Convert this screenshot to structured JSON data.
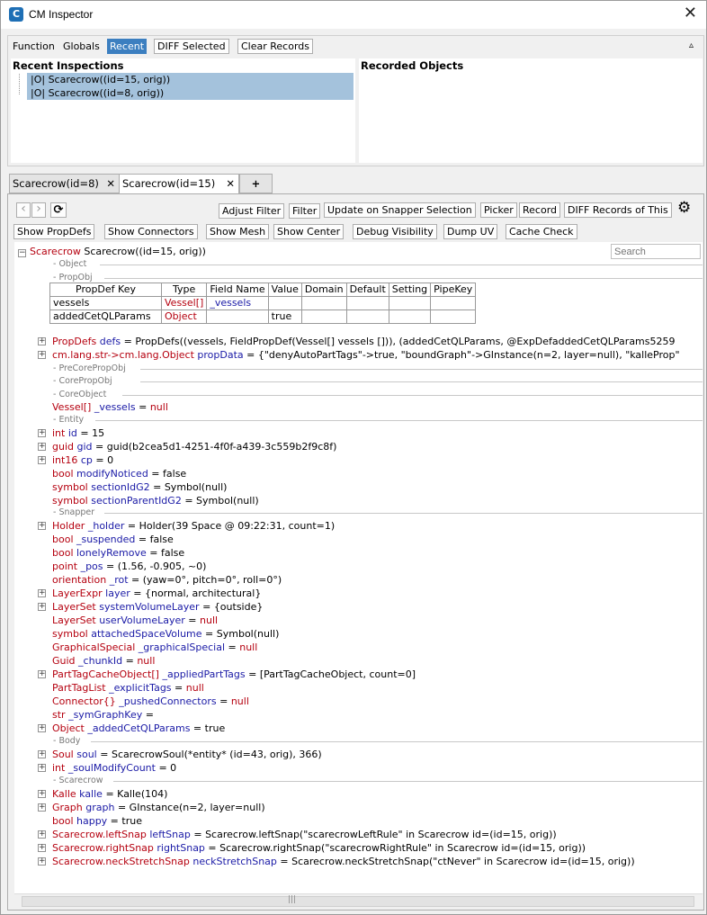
{
  "window": {
    "title": "CM Inspector",
    "close_glyph": "✕",
    "app_icon_letter": "C"
  },
  "toolbar_top": {
    "function": "Function",
    "globals": "Globals",
    "recent": "Recent",
    "diff_selected": "DIFF Selected",
    "clear_records": "Clear Records",
    "collapse_glyph": "▵"
  },
  "recent": {
    "header": "Recent Inspections",
    "items": [
      "|O|  Scarecrow((id=15, orig))",
      "|O|  Scarecrow((id=8, orig))"
    ]
  },
  "recorded": {
    "header": "Recorded Objects"
  },
  "tabs": [
    {
      "label": "Scarecrow(id=8)",
      "close": "✕"
    },
    {
      "label": "Scarecrow(id=15)",
      "close": "✕"
    },
    {
      "label": "+"
    }
  ],
  "toolbar1": {
    "back": "‹",
    "forward": "›",
    "refresh": "⟳",
    "adjust_filter": "Adjust Filter",
    "filter": "Filter",
    "update_on_snapper": "Update on Snapper Selection",
    "picker": "Picker",
    "record": "Record",
    "diff_records": "DIFF Records of This",
    "gear": "⚙"
  },
  "toolbar2": [
    "Show PropDefs",
    "Show Connectors",
    "Show Mesh",
    "Show Center",
    "Debug Visibility",
    "Dump UV",
    "Cache Check"
  ],
  "search": {
    "placeholder": "Search"
  },
  "root": {
    "type": "Scarecrow",
    "value": "Scarecrow((id=15, orig))"
  },
  "sections": {
    "object": "- Object",
    "propobj": "- PropObj",
    "precore": "- PreCorePropObj",
    "coreprop": "- CorePropObj",
    "coreobj": "- CoreObject",
    "entity": "- Entity",
    "snapper": "- Snapper",
    "body": "- Body",
    "scarecrow": "- Scarecrow"
  },
  "propdef_table": {
    "headers": [
      "PropDef Key",
      "Type",
      "Field Name",
      "Value",
      "Domain",
      "Default",
      "Setting",
      "PipeKey"
    ],
    "rows": [
      [
        "vessels",
        "Vessel[]",
        "_vessels",
        "",
        "",
        "",
        "",
        ""
      ],
      [
        "addedCetQLParams",
        "Object",
        "",
        "true",
        "",
        "",
        "",
        ""
      ]
    ]
  },
  "fields_a": [
    {
      "exp": true,
      "type": "PropDefs",
      "name": "defs",
      "eq": " = ",
      "value": "PropDefs((vessels, FieldPropDef(Vessel[] vessels [])), (addedCetQLParams, @ExpDefaddedCetQLParams5259"
    },
    {
      "exp": true,
      "type": "cm.lang.str->cm.lang.Object",
      "name": "propData",
      "eq": " = ",
      "value": "{\"denyAutoPartTags\"->true, \"boundGraph\"->GInstance(n=2, layer=null), \"kalleProp\""
    }
  ],
  "fields_coreobj": [
    {
      "exp": false,
      "type": "Vessel[]",
      "name": "_vessels",
      "eq": " = ",
      "value": "null",
      "null": true
    }
  ],
  "fields_entity": [
    {
      "exp": true,
      "type": "int",
      "name": "id",
      "eq": " = ",
      "value": "15"
    },
    {
      "exp": true,
      "type": "guid",
      "name": "gid",
      "eq": " = ",
      "value": "guid(b2cea5d1-4251-4f0f-a439-3c559b2f9c8f)"
    },
    {
      "exp": true,
      "type": "int16",
      "name": "cp",
      "eq": " = ",
      "value": "0"
    },
    {
      "exp": false,
      "type": "bool",
      "name": "modifyNoticed",
      "eq": " = ",
      "value": "false"
    },
    {
      "exp": false,
      "type": "symbol",
      "name": "sectionIdG2",
      "eq": " = ",
      "value": "Symbol(null)"
    },
    {
      "exp": false,
      "type": "symbol",
      "name": "sectionParentIdG2",
      "eq": " = ",
      "value": "Symbol(null)"
    }
  ],
  "fields_snapper": [
    {
      "exp": true,
      "type": "Holder",
      "name": "_holder",
      "eq": " = ",
      "value": "Holder(39 Space @ 09:22:31, count=1)"
    },
    {
      "exp": false,
      "type": "bool",
      "name": "_suspended",
      "eq": " = ",
      "value": "false"
    },
    {
      "exp": false,
      "type": "bool",
      "name": "lonelyRemove",
      "eq": " = ",
      "value": "false"
    },
    {
      "exp": false,
      "type": "point",
      "name": "_pos",
      "eq": " = ",
      "value": "(1.56, -0.905, ~0)"
    },
    {
      "exp": false,
      "type": "orientation",
      "name": "_rot",
      "eq": " = ",
      "value": "(yaw=0°, pitch=0°, roll=0°)"
    },
    {
      "exp": true,
      "type": "LayerExpr",
      "name": "layer",
      "eq": " = ",
      "value": "{normal, architectural}"
    },
    {
      "exp": true,
      "type": "LayerSet",
      "name": "systemVolumeLayer",
      "eq": " = ",
      "value": "{outside}"
    },
    {
      "exp": false,
      "type": "LayerSet",
      "name": "userVolumeLayer",
      "eq": " = ",
      "value": "null",
      "null": true
    },
    {
      "exp": false,
      "type": "symbol",
      "name": "attachedSpaceVolume",
      "eq": " = ",
      "value": "Symbol(null)"
    },
    {
      "exp": false,
      "type": "GraphicalSpecial",
      "name": "_graphicalSpecial",
      "eq": " = ",
      "value": "null",
      "null": true
    },
    {
      "exp": false,
      "type": "Guid",
      "name": "_chunkId",
      "eq": " = ",
      "value": "null",
      "null": true
    },
    {
      "exp": true,
      "type": "PartTagCacheObject[]",
      "name": "_appliedPartTags",
      "eq": " = ",
      "value": "[PartTagCacheObject, count=0]"
    },
    {
      "exp": false,
      "type": "PartTagList",
      "name": "_explicitTags",
      "eq": " = ",
      "value": "null",
      "null": true
    },
    {
      "exp": false,
      "type": "Connector{}",
      "name": "_pushedConnectors",
      "eq": " = ",
      "value": "null",
      "null": true
    },
    {
      "exp": false,
      "type": "str",
      "name": "_symGraphKey",
      "eq": " =",
      "value": ""
    },
    {
      "exp": true,
      "type": "Object",
      "name": "_addedCetQLParams",
      "eq": " = ",
      "value": "true"
    }
  ],
  "fields_body": [
    {
      "exp": true,
      "type": "Soul",
      "name": "soul",
      "eq": " = ",
      "value": "ScarecrowSoul(*entity* (id=43, orig), 366)"
    },
    {
      "exp": true,
      "type": "int",
      "name": "_soulModifyCount",
      "eq": " = ",
      "value": "0"
    }
  ],
  "fields_scarecrow": [
    {
      "exp": true,
      "type": "Kalle",
      "name": "kalle",
      "eq": " = ",
      "value": "Kalle(104)"
    },
    {
      "exp": true,
      "type": "Graph",
      "name": "graph",
      "eq": " = ",
      "value": "GInstance(n=2, layer=null)"
    },
    {
      "exp": false,
      "type": "bool",
      "name": "happy",
      "eq": " = ",
      "value": "true"
    },
    {
      "exp": true,
      "type": "Scarecrow.leftSnap",
      "name": "leftSnap",
      "eq": " = ",
      "value": "Scarecrow.leftSnap(\"scarecrowLeftRule\" in Scarecrow id=(id=15, orig))"
    },
    {
      "exp": true,
      "type": "Scarecrow.rightSnap",
      "name": "rightSnap",
      "eq": " = ",
      "value": "Scarecrow.rightSnap(\"scarecrowRightRule\" in Scarecrow id=(id=15, orig))"
    },
    {
      "exp": true,
      "type": "Scarecrow.neckStretchSnap",
      "name": "neckStretchSnap",
      "eq": " = ",
      "value": "Scarecrow.neckStretchSnap(\"ctNever\" in Scarecrow id=(id=15, orig))"
    }
  ],
  "scroll": {
    "grip": "|||"
  }
}
